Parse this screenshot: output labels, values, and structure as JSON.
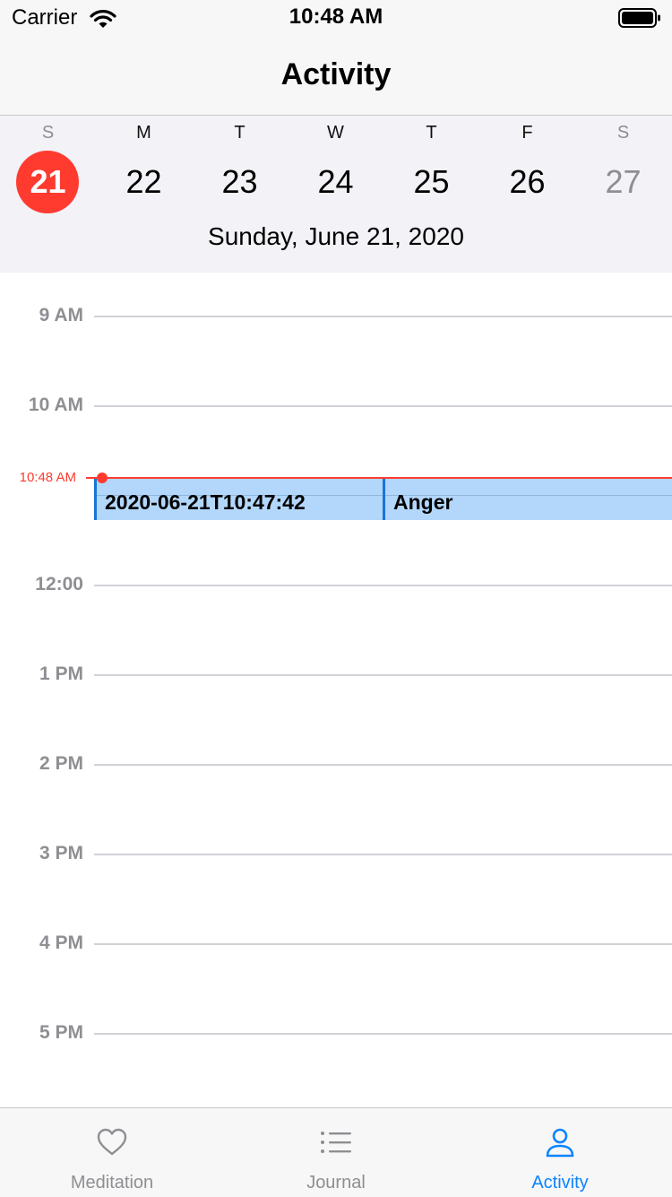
{
  "status_bar": {
    "carrier": "Carrier",
    "time": "10:48 AM"
  },
  "nav": {
    "title": "Activity"
  },
  "week": {
    "days": [
      {
        "letter": "S",
        "number": "21"
      },
      {
        "letter": "M",
        "number": "22"
      },
      {
        "letter": "T",
        "number": "23"
      },
      {
        "letter": "W",
        "number": "24"
      },
      {
        "letter": "T",
        "number": "25"
      },
      {
        "letter": "F",
        "number": "26"
      },
      {
        "letter": "S",
        "number": "27"
      }
    ],
    "selected_index": 0,
    "selected_date": "Sunday, June 21, 2020"
  },
  "timeline": {
    "hours": [
      "9 AM",
      "10 AM",
      "",
      "12:00",
      "1 PM",
      "2 PM",
      "3 PM",
      "4 PM",
      "5 PM"
    ],
    "now_label": "10:48 AM",
    "events": [
      {
        "title": "2020-06-21T10:47:42"
      },
      {
        "title": "Anger"
      }
    ]
  },
  "tabs": [
    {
      "label": "Meditation",
      "icon": "heart-icon",
      "active": false
    },
    {
      "label": "Journal",
      "icon": "list-icon",
      "active": false
    },
    {
      "label": "Activity",
      "icon": "person-icon",
      "active": true
    }
  ],
  "colors": {
    "accent": "#0a84ff",
    "selected_day": "#ff3b30",
    "now_indicator": "#ff3b30",
    "event_fill": "#b3d7fb",
    "event_border": "#1a73d9"
  }
}
